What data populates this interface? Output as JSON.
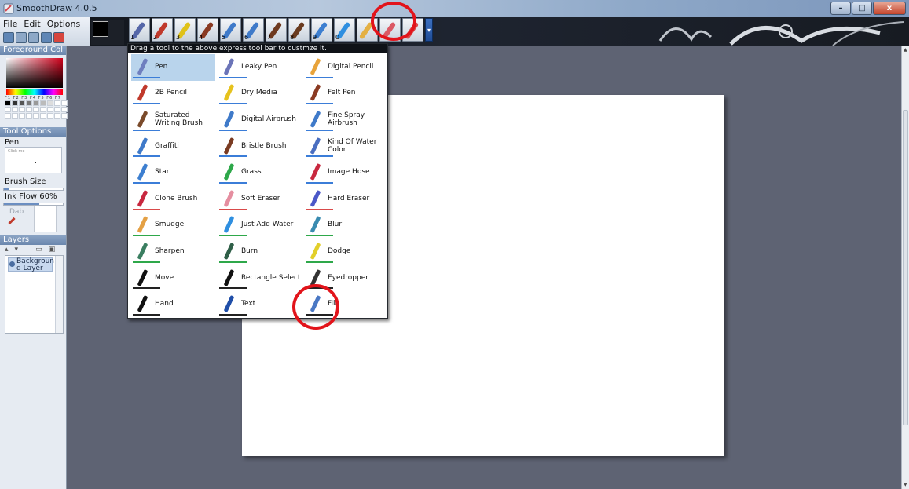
{
  "window": {
    "title": "SmoothDraw 4.0.5",
    "controls": [
      "–",
      "□",
      "x"
    ]
  },
  "menu": {
    "file": "File",
    "edit": "Edit",
    "options": "Options"
  },
  "express_toolbar": {
    "slot_numbers": [
      "1",
      "2",
      "3",
      "4",
      "5",
      "6",
      "7",
      "8",
      "9",
      "0",
      "",
      "",
      ""
    ],
    "slot_colors": [
      "#5667a8",
      "#c0392b",
      "#e0c21a",
      "#8a3a22",
      "#3f7ac9",
      "#3f7ac9",
      "#6f3a1f",
      "#6a3b1f",
      "#3d7fd0",
      "#2f8fe0",
      "#e4b044",
      "#db5964",
      "#d94a4a"
    ]
  },
  "panels": {
    "foreground": "Foreground Col",
    "fkeys": "F1 F2 F3 F4 F5 F6 F7 F8",
    "tool_options": "Tool Options",
    "tool_name": "Pen",
    "click_hint": "Click me",
    "brush_size_label": "Brush Size",
    "brush_size_level": 0.08,
    "ink_flow_label": "Ink Flow  60%",
    "ink_flow_level": 0.6,
    "dab_label": "Dab",
    "layers": "Layers",
    "layer_name": "Backgroun d Layer"
  },
  "tool_menu": {
    "hint": "Drag a tool to the above express tool bar to custmze it.",
    "tools": [
      {
        "label": "Pen",
        "color": "#6f7fbf",
        "underline": "#3b7dd8",
        "selected": true
      },
      {
        "label": "Leaky Pen",
        "color": "#6b74b8",
        "underline": "#3b7dd8"
      },
      {
        "label": "Digital Pencil",
        "color": "#e8a33a",
        "underline": "#3b7dd8"
      },
      {
        "label": "2B Pencil",
        "color": "#c0392b",
        "underline": "#3b7dd8"
      },
      {
        "label": "Dry Media",
        "color": "#e6c21d",
        "underline": "#3b7dd8"
      },
      {
        "label": "Felt Pen",
        "color": "#8a3a22",
        "underline": "#3b7dd8"
      },
      {
        "label": "Saturated Writing Brush",
        "color": "#7a4a2a",
        "underline": "#3b7dd8"
      },
      {
        "label": "Digital Airbrush",
        "color": "#3f7ac9",
        "underline": "#3b7dd8"
      },
      {
        "label": "Fine Spray Airbrush",
        "color": "#3f7ac9",
        "underline": "#3b7dd8"
      },
      {
        "label": "Graffiti",
        "color": "#3f7ac9",
        "underline": "#3b7dd8"
      },
      {
        "label": "Bristle Brush",
        "color": "#7a3b22",
        "underline": "#3b7dd8"
      },
      {
        "label": "Kind Of Water Color",
        "color": "#4a6ec0",
        "underline": "#3b7dd8"
      },
      {
        "label": "Star",
        "color": "#3d7fd0",
        "underline": "#3b7dd8"
      },
      {
        "label": "Grass",
        "color": "#2ea84a",
        "underline": "#3b7dd8"
      },
      {
        "label": "Image Hose",
        "color": "#c8283f",
        "underline": "#3b7dd8"
      },
      {
        "label": "Clone Brush",
        "color": "#c8283f",
        "underline": "#d94a4a"
      },
      {
        "label": "Soft Eraser",
        "color": "#e58ea0",
        "underline": "#d94a4a"
      },
      {
        "label": "Hard Eraser",
        "color": "#4b58c8",
        "underline": "#d94a4a"
      },
      {
        "label": "Smudge",
        "color": "#e4a044",
        "underline": "#2ea84a"
      },
      {
        "label": "Just Add Water",
        "color": "#2f8fe0",
        "underline": "#2ea84a"
      },
      {
        "label": "Blur",
        "color": "#3a8bb0",
        "underline": "#2ea84a"
      },
      {
        "label": "Sharpen",
        "color": "#3a7e60",
        "underline": "#2ea84a"
      },
      {
        "label": "Burn",
        "color": "#2f5f48",
        "underline": "#2ea84a"
      },
      {
        "label": "Dodge",
        "color": "#e2cf2a",
        "underline": "#2ea84a"
      },
      {
        "label": "Move",
        "color": "#111111",
        "underline": "#222222"
      },
      {
        "label": "Rectangle Select",
        "color": "#111111",
        "underline": "#222222"
      },
      {
        "label": "Eyedropper",
        "color": "#333333",
        "underline": "#222222"
      },
      {
        "label": "Hand",
        "color": "#111111",
        "underline": "#222222"
      },
      {
        "label": "Text",
        "color": "#1f4ea8",
        "underline": "#222222"
      },
      {
        "label": "Fill",
        "color": "#4a78c4",
        "underline": "#222222"
      }
    ]
  },
  "accent_red": "#e2141b"
}
